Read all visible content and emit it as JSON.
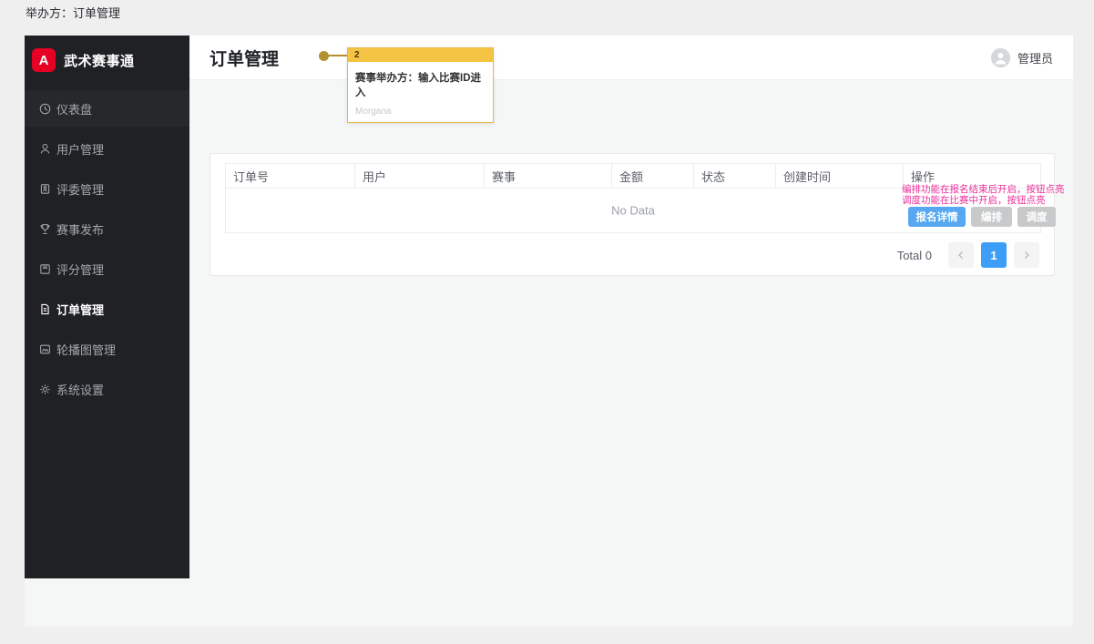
{
  "page": {
    "top_label": "举办方：订单管理"
  },
  "colors": {
    "outer_bg": "#efeff0",
    "content_bg": "#f5f6f6",
    "sidebar_bg": "#202125",
    "logo_red": "#e60023",
    "primary_blue": "#57a8f0",
    "pager_active_blue": "#3d9ef8",
    "disabled_grey": "#c8c9cb",
    "note_pink": "#ee2e9a",
    "annotation_yellow": "#f5c445",
    "annotation_gold": "#b2912e"
  },
  "sidebar": {
    "brand": {
      "logo_letter": "A",
      "name": "武术赛事通"
    },
    "items": [
      {
        "label": "仪表盘",
        "icon": "dashboard-icon",
        "active": false
      },
      {
        "label": "用户管理",
        "icon": "users-icon",
        "active": false
      },
      {
        "label": "评委管理",
        "icon": "judges-icon",
        "active": false
      },
      {
        "label": "赛事发布",
        "icon": "trophy-icon",
        "active": false
      },
      {
        "label": "评分管理",
        "icon": "scores-icon",
        "active": false
      },
      {
        "label": "订单管理",
        "icon": "orders-icon",
        "active": true
      },
      {
        "label": "轮播图管理",
        "icon": "carousel-icon",
        "active": false
      },
      {
        "label": "系统设置",
        "icon": "settings-icon",
        "active": false
      }
    ]
  },
  "header": {
    "title": "订单管理",
    "user": "管理员"
  },
  "annotation": {
    "badge": "2",
    "text": "赛事举办方：输入比赛ID进入",
    "watermark": "Morgana"
  },
  "table": {
    "columns": [
      "订单号",
      "用户",
      "赛事",
      "金额",
      "状态",
      "创建时间",
      "操作"
    ],
    "empty_text": "No Data",
    "ops_note_line1": "编排功能在报名结束后开启，按钮点亮",
    "ops_note_line2": "调度功能在比赛中开启，按钮点亮",
    "buttons": [
      {
        "label": "报名详情",
        "type": "primary"
      },
      {
        "label": "编排",
        "type": "disabled"
      },
      {
        "label": "调度",
        "type": "disabled"
      }
    ]
  },
  "pagination": {
    "total_text": "Total 0",
    "current_page": "1"
  }
}
